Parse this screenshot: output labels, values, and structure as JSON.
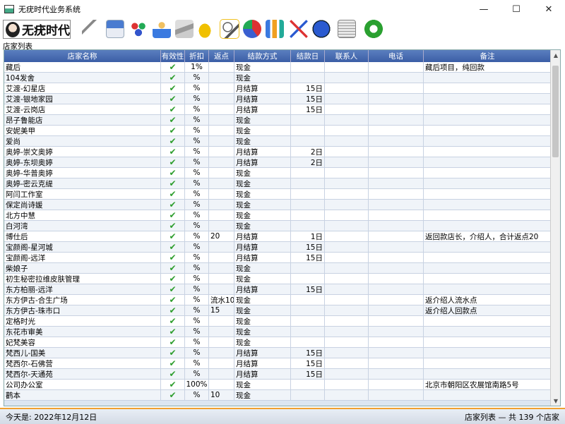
{
  "window": {
    "title": "无疣时代业务系统",
    "minimize": "—",
    "maximize": "☐",
    "close": "✕"
  },
  "logo": {
    "text": "无疣时代"
  },
  "toolbar": {
    "icons": [
      "syringe-icon",
      "building-icon",
      "users-icon",
      "person-gift-icon",
      "cash-register-icon",
      "car-icon",
      "search-icon",
      "pie-chart-icon",
      "bar-chart-icon",
      "tools-icon",
      "info-icon",
      "ledger-icon",
      "refresh-icon"
    ]
  },
  "section_label": "店家列表",
  "table": {
    "headers": [
      "店家名称",
      "有效性",
      "折扣",
      "返点",
      "结款方式",
      "结款日",
      "联系人",
      "电话",
      "备注"
    ],
    "rows": [
      {
        "name": "藏后",
        "disc": "1%",
        "rebate": "",
        "method": "现金",
        "day": "",
        "note": "藏后项目，纯回款"
      },
      {
        "name": "104发舍",
        "disc": "%",
        "rebate": "",
        "method": "现金",
        "day": "",
        "note": ""
      },
      {
        "name": "艾渡-幻星店",
        "disc": "%",
        "rebate": "",
        "method": "月结算",
        "day": "15日",
        "note": ""
      },
      {
        "name": "艾渡-银地家园",
        "disc": "%",
        "rebate": "",
        "method": "月结算",
        "day": "15日",
        "note": ""
      },
      {
        "name": "艾渡-云岗店",
        "disc": "%",
        "rebate": "",
        "method": "月结算",
        "day": "15日",
        "note": ""
      },
      {
        "name": "昂子鲁能店",
        "disc": "%",
        "rebate": "",
        "method": "现金",
        "day": "",
        "note": ""
      },
      {
        "name": "安妮美甲",
        "disc": "%",
        "rebate": "",
        "method": "现金",
        "day": "",
        "note": ""
      },
      {
        "name": "爱尚",
        "disc": "%",
        "rebate": "",
        "method": "现金",
        "day": "",
        "note": ""
      },
      {
        "name": "奥婷-崇文奥婷",
        "disc": "%",
        "rebate": "",
        "method": "月结算",
        "day": "2日",
        "note": ""
      },
      {
        "name": "奥婷-东坝奥婷",
        "disc": "%",
        "rebate": "",
        "method": "月结算",
        "day": "2日",
        "note": ""
      },
      {
        "name": "奥婷-华普奥婷",
        "disc": "%",
        "rebate": "",
        "method": "现金",
        "day": "",
        "note": ""
      },
      {
        "name": "奥婷-密云克缇",
        "disc": "%",
        "rebate": "",
        "method": "现金",
        "day": "",
        "note": ""
      },
      {
        "name": "阿闫工作室",
        "disc": "%",
        "rebate": "",
        "method": "现金",
        "day": "",
        "note": ""
      },
      {
        "name": "保定尚诗媛",
        "disc": "%",
        "rebate": "",
        "method": "现金",
        "day": "",
        "note": ""
      },
      {
        "name": "北方中慧",
        "disc": "%",
        "rebate": "",
        "method": "现金",
        "day": "",
        "note": ""
      },
      {
        "name": "白河湾",
        "disc": "%",
        "rebate": "",
        "method": "现金",
        "day": "",
        "note": ""
      },
      {
        "name": "博仕后",
        "disc": "%",
        "rebate": "20",
        "method": "月结算",
        "day": "1日",
        "note": "返回款店长，介绍人，合计返点20"
      },
      {
        "name": "宝颜阁-星河城",
        "disc": "%",
        "rebate": "",
        "method": "月结算",
        "day": "15日",
        "note": ""
      },
      {
        "name": "宝颜阁-远洋",
        "disc": "%",
        "rebate": "",
        "method": "月结算",
        "day": "15日",
        "note": ""
      },
      {
        "name": "柴娘子",
        "disc": "%",
        "rebate": "",
        "method": "现金",
        "day": "",
        "note": ""
      },
      {
        "name": "初生秘密拉维皮肤管理",
        "disc": "%",
        "rebate": "",
        "method": "现金",
        "day": "",
        "note": ""
      },
      {
        "name": "东方柏丽-远洋",
        "disc": "%",
        "rebate": "",
        "method": "月结算",
        "day": "15日",
        "note": ""
      },
      {
        "name": "东方伊古-合生广场",
        "disc": "%",
        "rebate": "流水10",
        "method": "现金",
        "day": "",
        "note": "返介绍人流水点"
      },
      {
        "name": "东方伊古-珠市口",
        "disc": "%",
        "rebate": "15",
        "method": "现金",
        "day": "",
        "note": "返介绍人回款点"
      },
      {
        "name": "定格时光",
        "disc": "%",
        "rebate": "",
        "method": "现金",
        "day": "",
        "note": ""
      },
      {
        "name": "东花市审美",
        "disc": "%",
        "rebate": "",
        "method": "现金",
        "day": "",
        "note": ""
      },
      {
        "name": "妃梵美容",
        "disc": "%",
        "rebate": "",
        "method": "现金",
        "day": "",
        "note": ""
      },
      {
        "name": "梵西儿-国美",
        "disc": "%",
        "rebate": "",
        "method": "月结算",
        "day": "15日",
        "note": ""
      },
      {
        "name": "梵西尔-石佛营",
        "disc": "%",
        "rebate": "",
        "method": "月结算",
        "day": "15日",
        "note": ""
      },
      {
        "name": "梵西尔-天通苑",
        "disc": "%",
        "rebate": "",
        "method": "月结算",
        "day": "15日",
        "note": ""
      },
      {
        "name": "公司办公室",
        "disc": "100%",
        "rebate": "",
        "method": "现金",
        "day": "",
        "note": "北京市朝阳区农展馆南路5号"
      },
      {
        "name": "鹳本",
        "disc": "%",
        "rebate": "10",
        "method": "现金",
        "day": "",
        "note": ""
      }
    ]
  },
  "status": {
    "date": "今天是: 2022年12月12日",
    "summary": "店家列表 — 共 139 个店家"
  }
}
